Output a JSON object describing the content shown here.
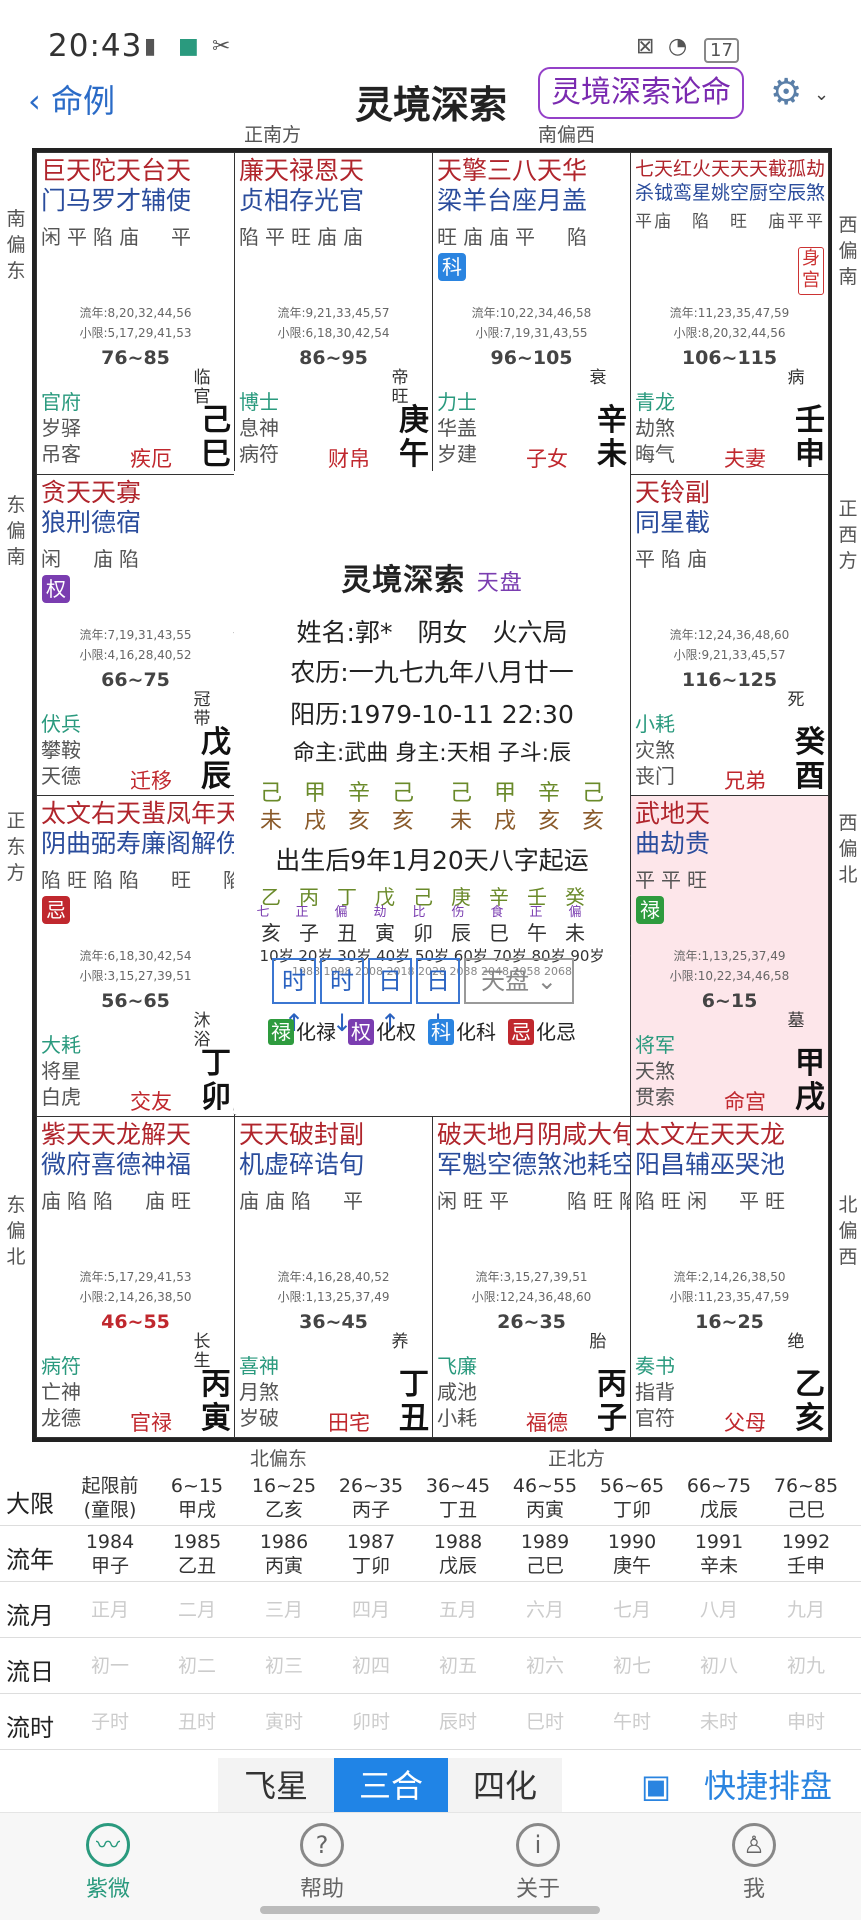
{
  "status": {
    "time": "20:43",
    "battery": "17"
  },
  "header": {
    "back": "命例",
    "title": "灵境深索",
    "lun_button": "灵境深索论命"
  },
  "dirs": {
    "top_left": "正南方",
    "top_right": "南偏西",
    "left1": "南偏东",
    "left2": "东偏南",
    "left3": "正东方",
    "left4": "东偏北",
    "right1": "西偏南",
    "right2": "正西方",
    "right3": "西偏北",
    "right4": "北偏西",
    "bottom_left": "北偏东",
    "bottom_right": "正北方"
  },
  "palaces": [
    {
      "id": "si",
      "s1": "巨天陀天台天",
      "s2": "门马罗才辅使",
      "b": "闲平陷庙　平",
      "liu1": "流年:8,20,32,44,56",
      "liu2": "小限:5,17,29,41,53",
      "dx": "76~85",
      "sheng": "临官",
      "b1": "官府",
      "b2": "岁驿",
      "b3": "吊客",
      "pal": "疾厄",
      "gz1": "己",
      "gz2": "巳"
    },
    {
      "id": "wu",
      "s1": "廉天禄恩天",
      "s2": "贞相存光官",
      "b": "陷平旺庙庙",
      "liu1": "流年:9,21,33,45,57",
      "liu2": "小限:6,18,30,42,54",
      "dx": "86~95",
      "sheng": "帝旺",
      "b1": "博士",
      "b2": "息神",
      "b3": "病符",
      "pal": "财帛",
      "gz1": "庚",
      "gz2": "午"
    },
    {
      "id": "wei",
      "s1": "天擎三八天华",
      "s2": "梁羊台座月盖",
      "b": "旺庙庙平　陷",
      "badge": "科",
      "liu1": "流年:10,22,34,46,58",
      "liu2": "小限:7,19,31,43,55",
      "dx": "96~105",
      "sheng": "衰",
      "b1": "力士",
      "b2": "华盖",
      "b3": "岁建",
      "pal": "子女",
      "gz1": "辛",
      "gz2": "未"
    },
    {
      "id": "shen",
      "s1": "七天红火天天天截孤劫",
      "s2": "杀钺鸾星姚空厨空辰煞",
      "b": "平庙　陷　旺　庙平平",
      "shen": "身宫",
      "liu1": "流年:11,23,35,47,59",
      "liu2": "小限:8,20,32,44,56",
      "dx": "106~115",
      "sheng": "病",
      "b1": "青龙",
      "b2": "劫煞",
      "b3": "晦气",
      "pal": "夫妻",
      "gz1": "壬",
      "gz2": "申"
    },
    {
      "id": "chen",
      "s1": "贪天天寡",
      "s2": "狼刑德宿",
      "b": "闲　庙陷",
      "badge": "权",
      "liu1": "流年:7,19,31,43,55",
      "liu2": "小限:4,16,28,40,52",
      "dx": "66~75",
      "sheng": "冠带",
      "b1": "伏兵",
      "b2": "攀鞍",
      "b3": "天德",
      "pal": "迁移",
      "gz1": "戊",
      "gz2": "辰"
    },
    {
      "id": "you",
      "s1": "天铃副",
      "s2": "同星截",
      "b": "平陷庙",
      "liu1": "流年:12,24,36,48,60",
      "liu2": "小限:9,21,33,45,57",
      "dx": "116~125",
      "sheng": "死",
      "b1": "小耗",
      "b2": "灾煞",
      "b3": "丧门",
      "pal": "兄弟",
      "gz1": "癸",
      "gz2": "酉"
    },
    {
      "id": "mao",
      "s1": "太文右天蜚凤年天",
      "s2": "阴曲弼寿廉阁解伤",
      "b": "陷旺陷陷　旺　陷",
      "badge": "忌",
      "liu1": "流年:6,18,30,42,54",
      "liu2": "小限:3,15,27,39,51",
      "dx": "56~65",
      "sheng": "沐浴",
      "b1": "大耗",
      "b2": "将星",
      "b3": "白虎",
      "pal": "交友",
      "gz1": "丁",
      "gz2": "卯"
    },
    {
      "id": "xu",
      "s1": "武地天",
      "s2": "曲劫贵",
      "b": "平平旺",
      "badge": "禄",
      "liu1": "流年:1,13,25,37,49",
      "liu2": "小限:10,22,34,46,58",
      "dx": "6~15",
      "sheng": "墓",
      "b1": "将军",
      "b2": "天煞",
      "b3": "贯索",
      "pal": "命宫",
      "gz1": "甲",
      "gz2": "戌"
    },
    {
      "id": "yin",
      "s1": "紫天天龙解天",
      "s2": "微府喜德神福",
      "b": "庙陷陷　庙旺",
      "liu1": "流年:5,17,29,41,53",
      "liu2": "小限:2,14,26,38,50",
      "dx": "46~55",
      "sheng": "长生",
      "b1": "病符",
      "b2": "亡神",
      "b3": "龙德",
      "pal": "官禄",
      "gz1": "丙",
      "gz2": "寅"
    },
    {
      "id": "chou",
      "s1": "天天破封副",
      "s2": "机虚碎诰旬",
      "b": "庙庙陷　平",
      "liu1": "流年:4,16,28,40,52",
      "liu2": "小限:1,13,25,37,49",
      "dx": "36~45",
      "sheng": "养",
      "b1": "喜神",
      "b2": "月煞",
      "b3": "岁破",
      "pal": "田宅",
      "gz1": "丁",
      "gz2": "丑"
    },
    {
      "id": "zi",
      "s1": "破天地月阴咸大旬",
      "s2": "军魁空德煞池耗空",
      "b": "闲旺平　　陷旺陷",
      "liu1": "流年:3,15,27,39,51",
      "liu2": "小限:12,24,36,48,60",
      "dx": "26~35",
      "sheng": "胎",
      "b1": "飞廉",
      "b2": "咸池",
      "b3": "小耗",
      "pal": "福德",
      "gz1": "丙",
      "gz2": "子"
    },
    {
      "id": "hai",
      "s1": "太文左天天龙",
      "s2": "阳昌辅巫哭池",
      "b": "陷旺闲　平旺",
      "liu1": "流年:2,14,26,38,50",
      "liu2": "小限:11,23,35,47,59",
      "dx": "16~25",
      "sheng": "绝",
      "b1": "奏书",
      "b2": "指背",
      "b3": "官符",
      "pal": "父母",
      "gz1": "乙",
      "gz2": "亥"
    }
  ],
  "center": {
    "brand": "灵境深索",
    "pan": "天盘",
    "name": "姓名:郭*　阴女　火六局",
    "lunar": "农历:一九七九年八月廿一",
    "solar": "阳历:1979-10-11 22:30",
    "ming": "命主:武曲 身主:天相 子斗:辰",
    "gz_top1": "己　甲　辛　己",
    "gz_bot1": "未　戌　亥　亥",
    "gz_top2": "己　甲　辛　己",
    "gz_bot2": "未　戌　亥　亥",
    "qiyun": "出生后9年1月20天八字起运",
    "dayun_top": "乙丙丁戊己庚辛壬癸",
    "dayun_ss": "七正偏劫比伤食正偏",
    "dayun_bot": "亥子丑寅卯辰巳午未",
    "ages": "10岁 20岁 30岁 40岁 50岁 60岁 70岁 80岁 90岁",
    "years": "1988  1998  2008  2018  2028  2038  2048  2058  2068",
    "btns": [
      "时↑",
      "时↓",
      "日↑",
      "日↓"
    ],
    "select": "天盘",
    "leg": [
      {
        "b": "禄",
        "t": "化禄",
        "c": "#2e9b3e"
      },
      {
        "b": "权",
        "t": "化权",
        "c": "#7a3db0"
      },
      {
        "b": "科",
        "t": "化科",
        "c": "#2a84e0"
      },
      {
        "b": "忌",
        "t": "化忌",
        "c": "#c0282e"
      }
    ]
  },
  "table": {
    "heads": [
      "大限",
      "流年",
      "流月",
      "流日",
      "流时"
    ],
    "daxian": [
      [
        "起限前",
        "(童限)"
      ],
      [
        "6~15",
        "甲戌"
      ],
      [
        "16~25",
        "乙亥"
      ],
      [
        "26~35",
        "丙子"
      ],
      [
        "36~45",
        "丁丑"
      ],
      [
        "46~55",
        "丙寅"
      ],
      [
        "56~65",
        "丁卯"
      ],
      [
        "66~75",
        "戊辰"
      ],
      [
        "76~85",
        "己巳"
      ]
    ],
    "liunian": [
      [
        "1984",
        "甲子"
      ],
      [
        "1985",
        "乙丑"
      ],
      [
        "1986",
        "丙寅"
      ],
      [
        "1987",
        "丁卯"
      ],
      [
        "1988",
        "戊辰"
      ],
      [
        "1989",
        "己巳"
      ],
      [
        "1990",
        "庚午"
      ],
      [
        "1991",
        "辛未"
      ],
      [
        "1992",
        "壬申"
      ]
    ],
    "liuyue": [
      "正月",
      "二月",
      "三月",
      "四月",
      "五月",
      "六月",
      "七月",
      "八月",
      "九月"
    ],
    "liuri": [
      "初一",
      "初二",
      "初三",
      "初四",
      "初五",
      "初六",
      "初七",
      "初八",
      "初九"
    ],
    "liushi": [
      "子时",
      "丑时",
      "寅时",
      "卯时",
      "辰时",
      "巳时",
      "午时",
      "未时",
      "申时"
    ]
  },
  "tabs": {
    "feixing": "飞星",
    "sanhe": "三合",
    "sihua": "四化",
    "quick": "快捷排盘"
  },
  "nav": [
    {
      "label": "紫微"
    },
    {
      "label": "帮助"
    },
    {
      "label": "关于"
    },
    {
      "label": "我"
    }
  ]
}
